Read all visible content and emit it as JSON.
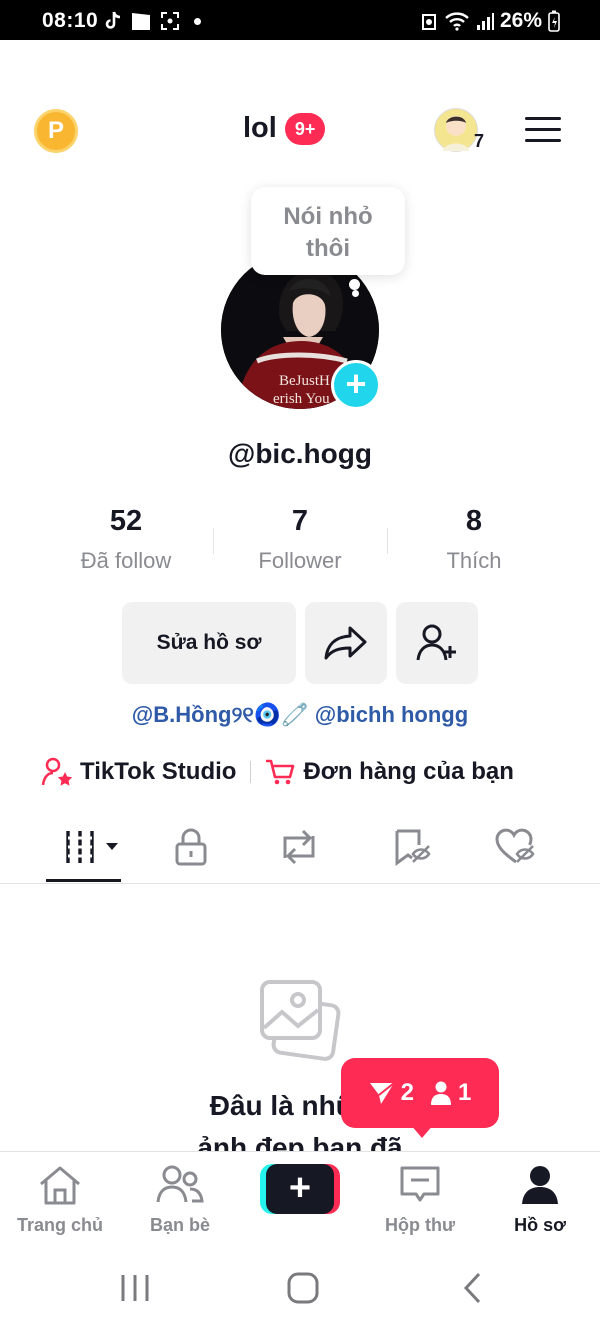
{
  "status_bar": {
    "time": "08:10",
    "battery": "26%"
  },
  "header": {
    "coin_letter": "P",
    "title": "lol",
    "notification_badge": "9+",
    "friend_avatar_count": "7"
  },
  "bubble": {
    "line1": "Nói nhỏ",
    "line2": "thôi"
  },
  "profile": {
    "username": "@bic.hogg"
  },
  "stats": [
    {
      "value": "52",
      "label": "Đã follow"
    },
    {
      "value": "7",
      "label": "Follower"
    },
    {
      "value": "8",
      "label": "Thích"
    }
  ],
  "actions": {
    "edit_label": "Sửa hồ sơ"
  },
  "bio_links": "@B.Hồng୨୧🧿🧷 @bichh hongg",
  "shortcuts": {
    "studio": "TikTok Studio",
    "orders": "Đơn hàng của bạn"
  },
  "empty_state": {
    "line1": "Đâu là những",
    "line2": "ảnh đẹp bạn đã"
  },
  "notification_popup": {
    "shares": "2",
    "followers": "1"
  },
  "bottom_nav": {
    "home": "Trang chủ",
    "friends": "Bạn bè",
    "inbox": "Hộp thư",
    "profile": "Hồ sơ"
  },
  "colors": {
    "accent": "#fe2c55",
    "cyan": "#20d5ec",
    "link": "#2e5aa7",
    "muted": "#8a8b91"
  }
}
